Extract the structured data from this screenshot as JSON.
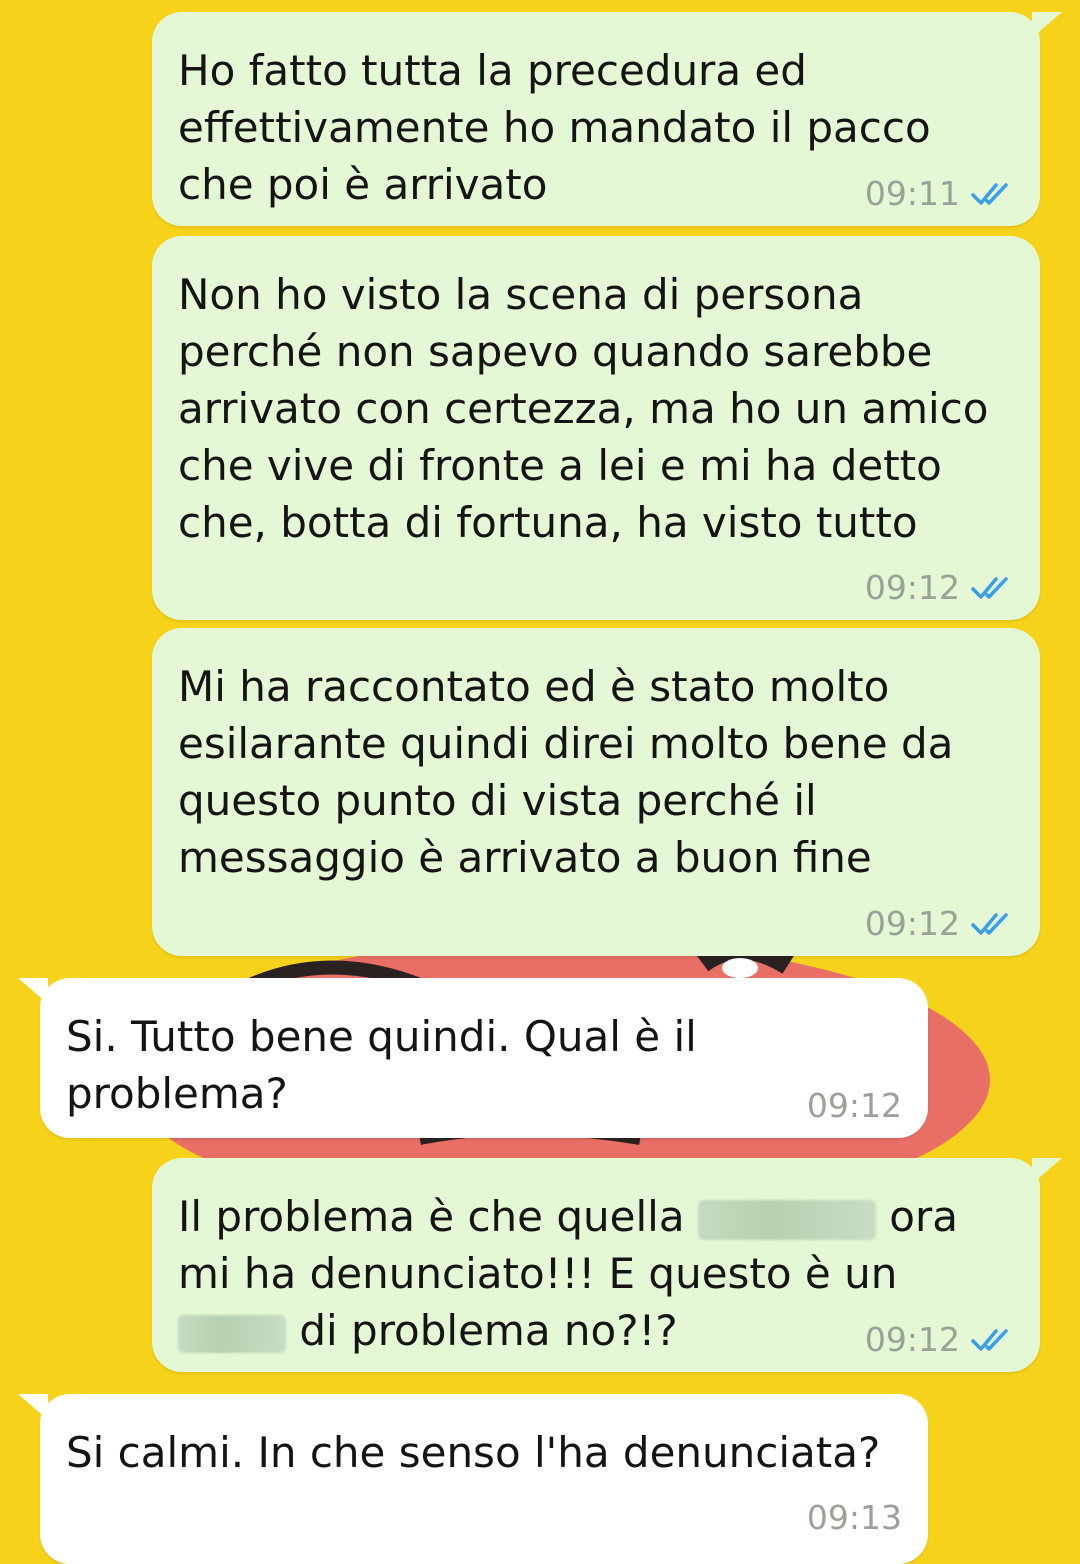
{
  "colors": {
    "background": "#f7d21a",
    "outgoing_bubble": "#e4f8d5",
    "incoming_bubble": "#ffffff",
    "timestamp": "#9aa197",
    "read_ticks": "#3a9ee8"
  },
  "messages": [
    {
      "direction": "outgoing",
      "text": "Ho fatto tutta la precedura ed effettivamente ho mandato il pacco che poi è arrivato",
      "time": "09:11",
      "status_icon": "double-check-read-icon"
    },
    {
      "direction": "outgoing",
      "text": "Non ho visto la scena di persona perché non sapevo quando sarebbe arrivato con certezza, ma ho un amico che vive di fronte a lei e mi ha detto che, botta di fortuna, ha visto tutto",
      "time": "09:12",
      "status_icon": "double-check-read-icon"
    },
    {
      "direction": "outgoing",
      "text": "Mi ha raccontato ed è stato molto esilarante quindi direi molto bene da questo punto di vista perché il messaggio è arrivato a buon fine",
      "time": "09:12",
      "status_icon": "double-check-read-icon"
    },
    {
      "direction": "incoming",
      "text": "Si. Tutto bene quindi. Qual è il problema?",
      "time": "09:12"
    },
    {
      "direction": "outgoing",
      "text_part1": "Il problema è che quella",
      "text_part2": "ora mi ha denunciato!!! E questo è un",
      "text_part3": "di problema no?!?",
      "time": "09:12",
      "status_icon": "double-check-read-icon"
    },
    {
      "direction": "incoming",
      "text": "Si calmi. In che senso l'ha denunciata?",
      "time": "09:13"
    }
  ]
}
